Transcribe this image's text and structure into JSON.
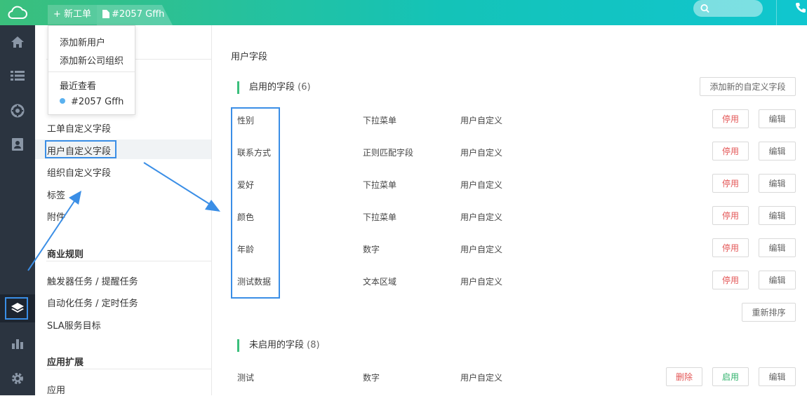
{
  "topbar": {
    "new_ticket": "+ 新工单",
    "tab_label": "#2057 Gffh",
    "search_placeholder": ""
  },
  "dropdown": {
    "items": [
      "添加新用户",
      "添加新公司组织",
      "最近查看"
    ],
    "recent": "#2057 Gffh"
  },
  "sidebar": {
    "partial_items": [
      "附件"
    ],
    "items": [
      "工单自定义字段",
      "用户自定义字段",
      "组织自定义字段",
      "标签",
      "附件"
    ],
    "section_business": "商业规则",
    "business_items": [
      "触发器任务 / 提醒任务",
      "自动化任务 / 定时任务",
      "SLA服务目标"
    ],
    "section_apps": "应用扩展",
    "app_items": [
      "应用"
    ]
  },
  "main": {
    "title": "用户字段",
    "enabled": {
      "label": "启用的字段",
      "count": "(6)"
    },
    "add_button": "添加新的自定义字段",
    "rows": [
      {
        "name": "性别",
        "type": "下拉菜单",
        "source": "用户自定义"
      },
      {
        "name": "联系方式",
        "type": "正则匹配字段",
        "source": "用户自定义"
      },
      {
        "name": "爱好",
        "type": "下拉菜单",
        "source": "用户自定义"
      },
      {
        "name": "颜色",
        "type": "下拉菜单",
        "source": "用户自定义"
      },
      {
        "name": "年龄",
        "type": "数字",
        "source": "用户自定义"
      },
      {
        "name": "测试数据",
        "type": "文本区域",
        "source": "用户自定义"
      }
    ],
    "disable_label": "停用",
    "edit_label": "编辑",
    "reorder_label": "重新排序",
    "disabled": {
      "label": "未启用的字段",
      "count": "(8)"
    },
    "disabled_rows": [
      {
        "name": "测试",
        "type": "数字",
        "source": "用户自定义"
      }
    ],
    "delete_label": "删除",
    "enable_label": "启用"
  },
  "colors": {
    "accent": "#3bbf7c",
    "highlight": "#3a8ee6",
    "danger": "#e35656",
    "nav_bg": "#2b3440"
  }
}
